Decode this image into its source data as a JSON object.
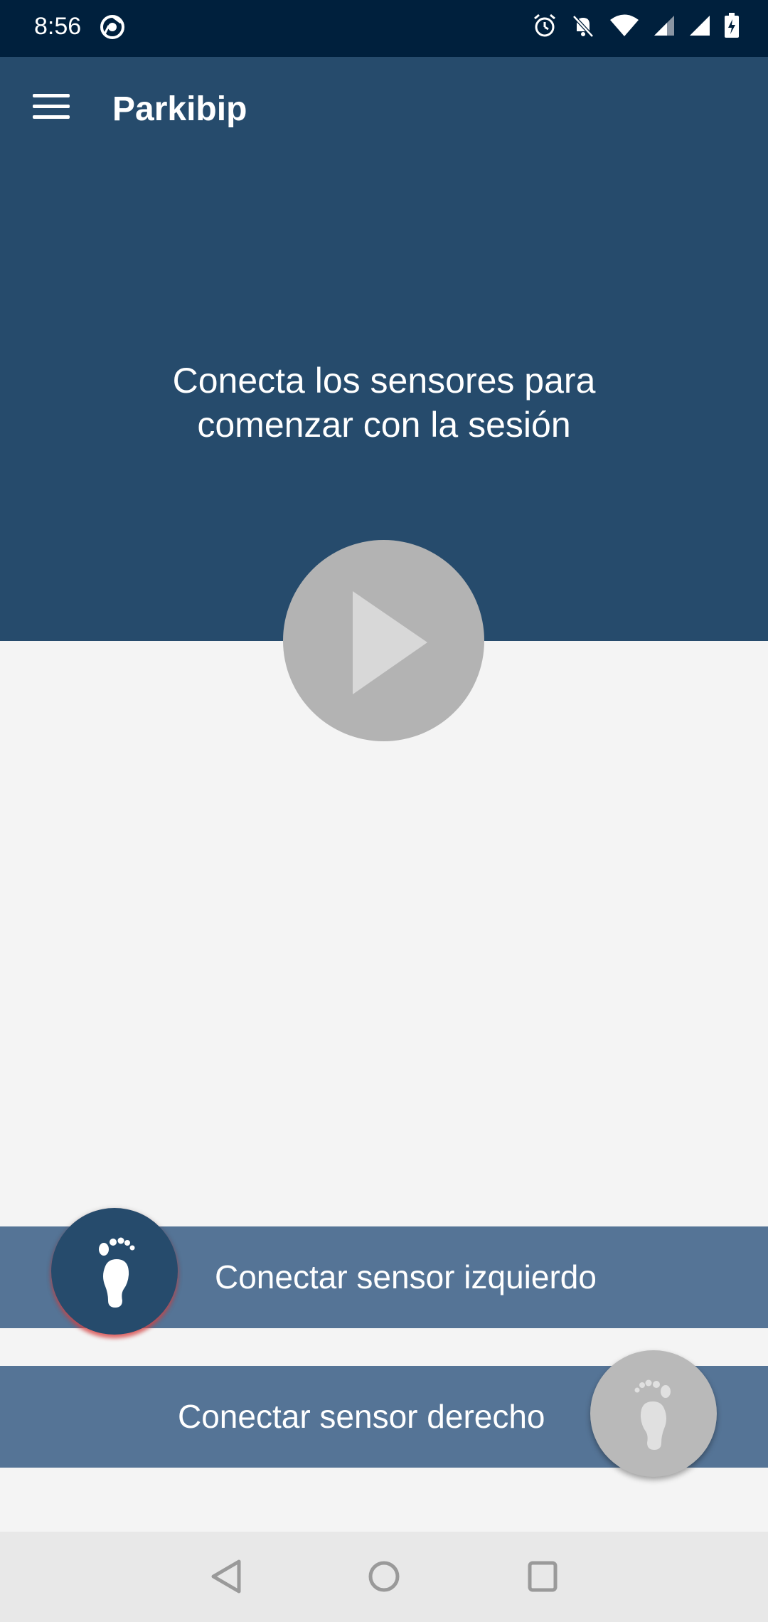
{
  "status_bar": {
    "time": "8:56",
    "icons": [
      "chrome-icon",
      "alarm-icon",
      "notifications-off-icon",
      "wifi-icon",
      "signal-icon",
      "signal-icon",
      "battery-charging-icon"
    ]
  },
  "app_bar": {
    "title": "Parkibip",
    "menu_icon": "hamburger-menu-icon"
  },
  "hero": {
    "message": "Conecta los sensores para\ncomenzar con la sesión"
  },
  "play_button": {
    "icon": "play-icon"
  },
  "sensors": {
    "left": {
      "label": "Conectar sensor izquierdo",
      "icon": "foot-icon"
    },
    "right": {
      "label": "Conectar sensor derecho",
      "icon": "foot-icon"
    }
  },
  "nav_bar": {
    "buttons": [
      "back-icon",
      "home-icon",
      "recent-apps-icon"
    ]
  },
  "colors": {
    "primary": "#264b6c",
    "sensor_bar": "#557496",
    "status_bar": "#00203d",
    "accent_glow": "#e64646",
    "disabled": "#b3b3b3"
  }
}
